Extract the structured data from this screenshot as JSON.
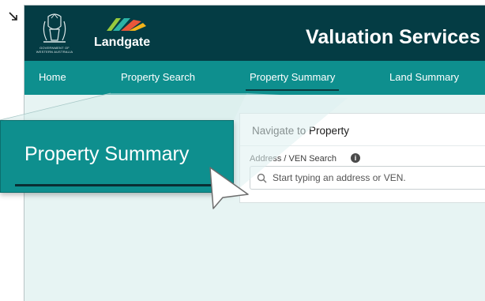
{
  "header": {
    "crest_text": [
      "GOVERNMENT OF",
      "WESTERN AUSTRALIA"
    ],
    "logo_text": "Landgate",
    "app_title": "Valuation Services"
  },
  "nav": {
    "items": [
      {
        "label": "Home"
      },
      {
        "label": "Property Search"
      },
      {
        "label": "Property Summary",
        "active": true
      },
      {
        "label": "Land Summary"
      }
    ]
  },
  "panel": {
    "title": "Navigate to Property",
    "field_label": "Address / VEN Search",
    "info_icon": "info-icon",
    "search_placeholder": "Start typing an address or VEN."
  },
  "callout": {
    "label": "Property Summary"
  },
  "colors": {
    "header": "#043c44",
    "nav": "#0e8f8e",
    "callout": "#0e8f8e",
    "background": "#e7f4f3",
    "logo_fan": [
      "#f4b41a",
      "#e9563a",
      "#2bb3a7",
      "#97c93d"
    ]
  },
  "icons": {
    "crest": "government-crest-icon",
    "search": "search-icon",
    "cursor": "mouse-pointer-icon"
  }
}
